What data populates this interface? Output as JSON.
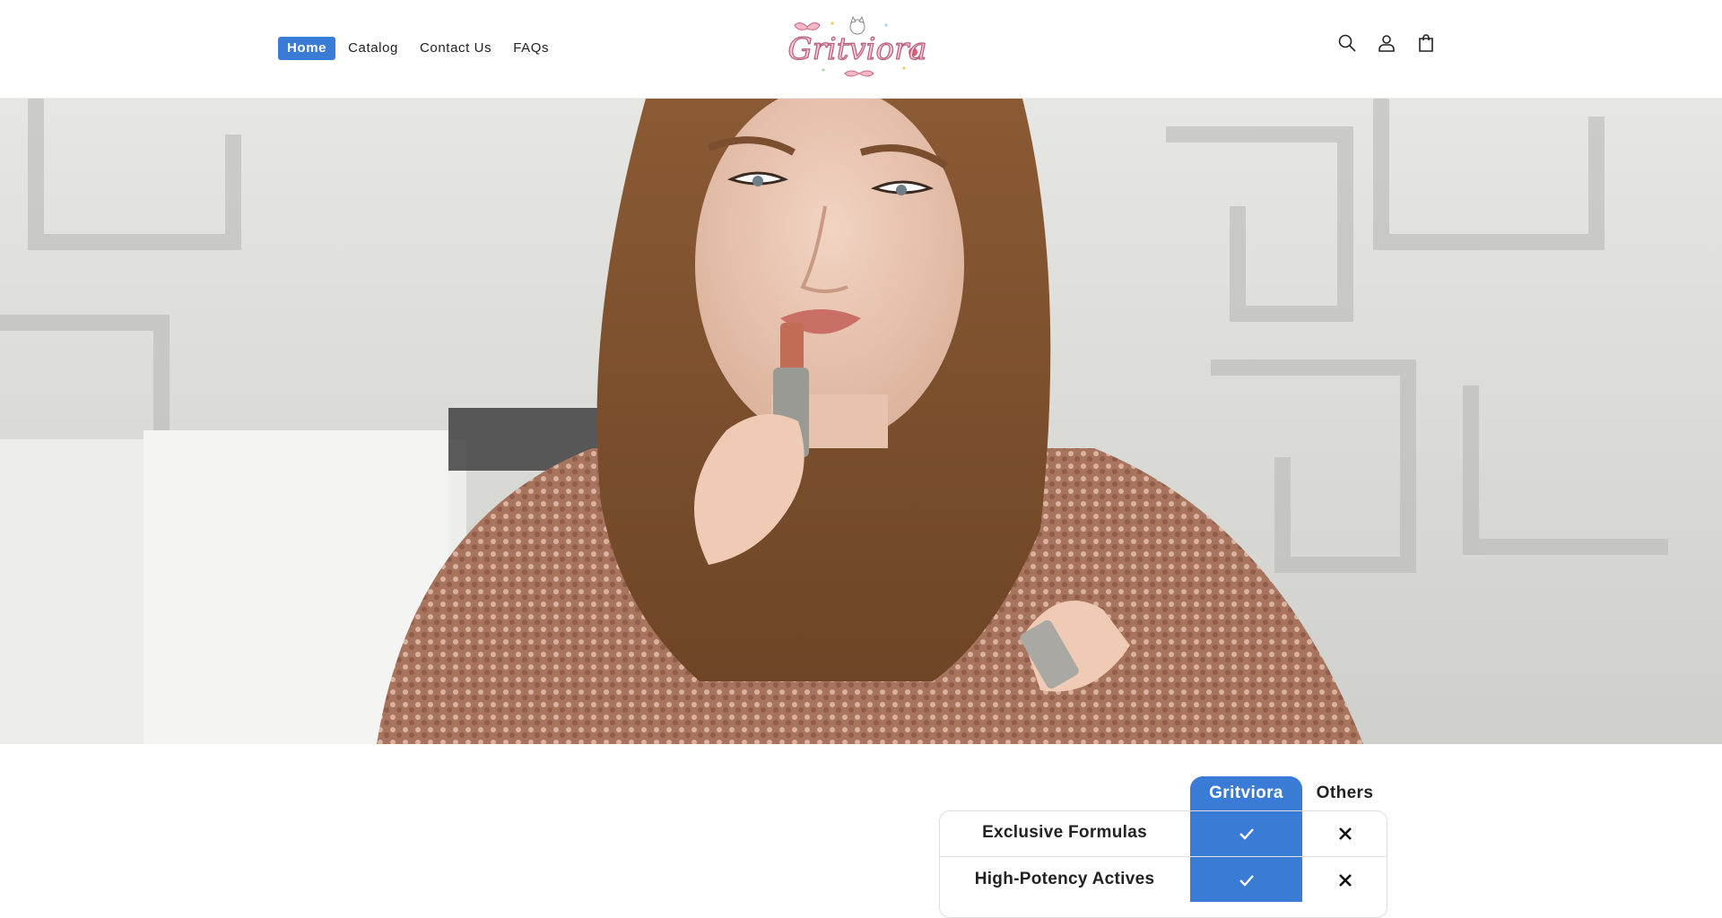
{
  "nav": {
    "items": [
      {
        "label": "Home",
        "active": true
      },
      {
        "label": "Catalog",
        "active": false
      },
      {
        "label": "Contact Us",
        "active": false
      },
      {
        "label": "FAQs",
        "active": false
      }
    ]
  },
  "brand": {
    "logo_text": "Gritviora",
    "accent_color": "#3a7bd5"
  },
  "header_icons": [
    "search-icon",
    "account-icon",
    "cart-icon"
  ],
  "hero": {
    "image_subject": "woman applying lipstick"
  },
  "comparison": {
    "brand_column": "Gritviora",
    "others_column": "Others",
    "rows": [
      {
        "feature": "Exclusive Formulas",
        "brand": "check",
        "others": "cross"
      },
      {
        "feature": "High-Potency Actives",
        "brand": "check",
        "others": "cross"
      }
    ]
  }
}
